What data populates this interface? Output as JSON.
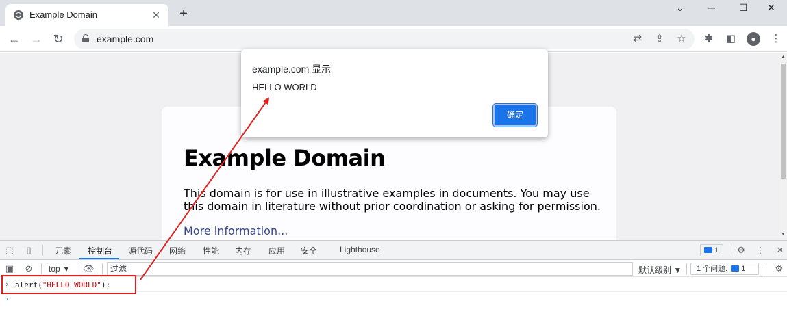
{
  "browser": {
    "tab_title": "Example Domain",
    "tab_close": "✕",
    "new_tab": "+",
    "url": "example.com",
    "window_controls": {
      "minimize": "─",
      "maximize": "☐",
      "close": "✕",
      "dropdown": "⌄"
    }
  },
  "page": {
    "heading": "Example Domain",
    "description": "This domain is for use in illustrative examples in documents. You may use this domain in literature without prior coordination or asking for permission.",
    "link": "More information..."
  },
  "alert": {
    "title": "example.com 显示",
    "message": "HELLO WORLD",
    "ok_label": "确定"
  },
  "devtools": {
    "tabs": [
      "元素",
      "控制台",
      "源代码",
      "网络",
      "性能",
      "内存",
      "应用",
      "安全",
      "Lighthouse"
    ],
    "active_tab": "控制台",
    "issues_badge": "1",
    "context": "top ▼",
    "filter_placeholder": "过滤",
    "log_levels": "默认级别 ▼",
    "issues_label": "1 个问题:",
    "issues_count": "1",
    "console_prefix": "alert(",
    "console_string": "\"HELLO WORLD\"",
    "console_suffix": ");",
    "prompt_symbol": "›"
  },
  "colors": {
    "accent": "#1a73e8",
    "annotation": "#e02020",
    "console_string": "#c80000"
  }
}
